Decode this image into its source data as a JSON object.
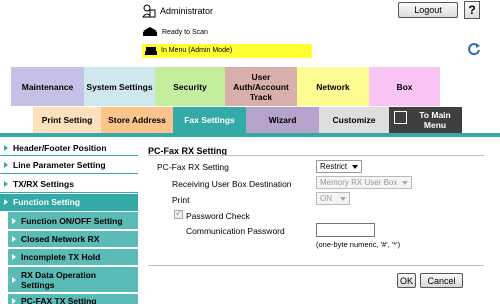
{
  "header": {
    "user": "Administrator",
    "logout_label": "Logout",
    "help_label": "?",
    "status": "Ready to Scan",
    "mode": "In Menu (Admin Mode)"
  },
  "top_tabs": [
    "Maintenance",
    "System Settings",
    "Security",
    "User Auth/Account Track",
    "Network",
    "Box"
  ],
  "sub_tabs": [
    "Print Setting",
    "Store Address",
    "Fax Settings",
    "Wizard",
    "Customize",
    "To Main Menu"
  ],
  "left_menu": [
    {
      "label": "Header/Footer Position"
    },
    {
      "label": "Line Parameter Setting"
    },
    {
      "label": "TX/RX Settings"
    },
    {
      "label": "Function Setting"
    },
    {
      "label": "Function ON/OFF Setting"
    },
    {
      "label": "Closed Network RX"
    },
    {
      "label": "Incomplete TX Hold"
    },
    {
      "label": "RX Data Operation Settings"
    },
    {
      "label": "PC-FAX TX Setting"
    }
  ],
  "content": {
    "title": "PC-Fax RX Setting",
    "rx_setting_label": "PC-Fax RX Setting",
    "rx_setting_value": "Restrict",
    "box_dest_label": "Receiving User Box Destination",
    "box_dest_value": "Memory RX User Box",
    "print_label": "Print",
    "print_value": "ON",
    "pw_check_label": "Password Check",
    "pw_check_checked": true,
    "comm_pw_label": "Communication Password",
    "comm_pw_value": "",
    "hint": "(one-byte numeric, '#', '*')",
    "ok_label": "OK",
    "cancel_label": "Cancel"
  },
  "colors": {
    "accent": "#33aaa5",
    "mode_bar": "#ffff33",
    "main_menu_tab": "#3f3f3f"
  }
}
